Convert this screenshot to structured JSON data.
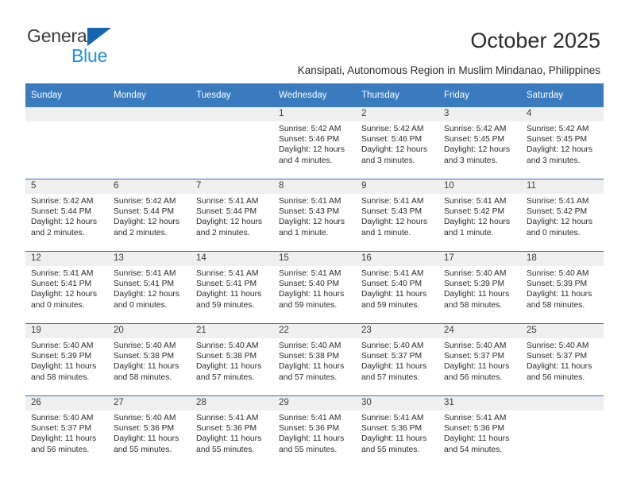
{
  "brand": {
    "name_top": "General",
    "name_bottom": "Blue",
    "triangle_color": "#1466b0",
    "blue_color": "#1e8fe0"
  },
  "header": {
    "month_title": "October 2025",
    "location": "Kansipati, Autonomous Region in Muslim Mindanao, Philippines",
    "header_bg": "#3a7bbf",
    "row_border": "#2f6eb0",
    "date_band_bg": "#efefef"
  },
  "weekdays": [
    "Sunday",
    "Monday",
    "Tuesday",
    "Wednesday",
    "Thursday",
    "Friday",
    "Saturday"
  ],
  "weeks": [
    [
      {
        "day": "",
        "empty": true
      },
      {
        "day": "",
        "empty": true
      },
      {
        "day": "",
        "empty": true
      },
      {
        "day": "1",
        "sunrise": "Sunrise: 5:42 AM",
        "sunset": "Sunset: 5:46 PM",
        "daylight": "Daylight: 12 hours and 4 minutes."
      },
      {
        "day": "2",
        "sunrise": "Sunrise: 5:42 AM",
        "sunset": "Sunset: 5:46 PM",
        "daylight": "Daylight: 12 hours and 3 minutes."
      },
      {
        "day": "3",
        "sunrise": "Sunrise: 5:42 AM",
        "sunset": "Sunset: 5:45 PM",
        "daylight": "Daylight: 12 hours and 3 minutes."
      },
      {
        "day": "4",
        "sunrise": "Sunrise: 5:42 AM",
        "sunset": "Sunset: 5:45 PM",
        "daylight": "Daylight: 12 hours and 3 minutes."
      }
    ],
    [
      {
        "day": "5",
        "sunrise": "Sunrise: 5:42 AM",
        "sunset": "Sunset: 5:44 PM",
        "daylight": "Daylight: 12 hours and 2 minutes."
      },
      {
        "day": "6",
        "sunrise": "Sunrise: 5:42 AM",
        "sunset": "Sunset: 5:44 PM",
        "daylight": "Daylight: 12 hours and 2 minutes."
      },
      {
        "day": "7",
        "sunrise": "Sunrise: 5:41 AM",
        "sunset": "Sunset: 5:44 PM",
        "daylight": "Daylight: 12 hours and 2 minutes."
      },
      {
        "day": "8",
        "sunrise": "Sunrise: 5:41 AM",
        "sunset": "Sunset: 5:43 PM",
        "daylight": "Daylight: 12 hours and 1 minute."
      },
      {
        "day": "9",
        "sunrise": "Sunrise: 5:41 AM",
        "sunset": "Sunset: 5:43 PM",
        "daylight": "Daylight: 12 hours and 1 minute."
      },
      {
        "day": "10",
        "sunrise": "Sunrise: 5:41 AM",
        "sunset": "Sunset: 5:42 PM",
        "daylight": "Daylight: 12 hours and 1 minute."
      },
      {
        "day": "11",
        "sunrise": "Sunrise: 5:41 AM",
        "sunset": "Sunset: 5:42 PM",
        "daylight": "Daylight: 12 hours and 0 minutes."
      }
    ],
    [
      {
        "day": "12",
        "sunrise": "Sunrise: 5:41 AM",
        "sunset": "Sunset: 5:41 PM",
        "daylight": "Daylight: 12 hours and 0 minutes."
      },
      {
        "day": "13",
        "sunrise": "Sunrise: 5:41 AM",
        "sunset": "Sunset: 5:41 PM",
        "daylight": "Daylight: 12 hours and 0 minutes."
      },
      {
        "day": "14",
        "sunrise": "Sunrise: 5:41 AM",
        "sunset": "Sunset: 5:41 PM",
        "daylight": "Daylight: 11 hours and 59 minutes."
      },
      {
        "day": "15",
        "sunrise": "Sunrise: 5:41 AM",
        "sunset": "Sunset: 5:40 PM",
        "daylight": "Daylight: 11 hours and 59 minutes."
      },
      {
        "day": "16",
        "sunrise": "Sunrise: 5:41 AM",
        "sunset": "Sunset: 5:40 PM",
        "daylight": "Daylight: 11 hours and 59 minutes."
      },
      {
        "day": "17",
        "sunrise": "Sunrise: 5:40 AM",
        "sunset": "Sunset: 5:39 PM",
        "daylight": "Daylight: 11 hours and 58 minutes."
      },
      {
        "day": "18",
        "sunrise": "Sunrise: 5:40 AM",
        "sunset": "Sunset: 5:39 PM",
        "daylight": "Daylight: 11 hours and 58 minutes."
      }
    ],
    [
      {
        "day": "19",
        "sunrise": "Sunrise: 5:40 AM",
        "sunset": "Sunset: 5:39 PM",
        "daylight": "Daylight: 11 hours and 58 minutes."
      },
      {
        "day": "20",
        "sunrise": "Sunrise: 5:40 AM",
        "sunset": "Sunset: 5:38 PM",
        "daylight": "Daylight: 11 hours and 58 minutes."
      },
      {
        "day": "21",
        "sunrise": "Sunrise: 5:40 AM",
        "sunset": "Sunset: 5:38 PM",
        "daylight": "Daylight: 11 hours and 57 minutes."
      },
      {
        "day": "22",
        "sunrise": "Sunrise: 5:40 AM",
        "sunset": "Sunset: 5:38 PM",
        "daylight": "Daylight: 11 hours and 57 minutes."
      },
      {
        "day": "23",
        "sunrise": "Sunrise: 5:40 AM",
        "sunset": "Sunset: 5:37 PM",
        "daylight": "Daylight: 11 hours and 57 minutes."
      },
      {
        "day": "24",
        "sunrise": "Sunrise: 5:40 AM",
        "sunset": "Sunset: 5:37 PM",
        "daylight": "Daylight: 11 hours and 56 minutes."
      },
      {
        "day": "25",
        "sunrise": "Sunrise: 5:40 AM",
        "sunset": "Sunset: 5:37 PM",
        "daylight": "Daylight: 11 hours and 56 minutes."
      }
    ],
    [
      {
        "day": "26",
        "sunrise": "Sunrise: 5:40 AM",
        "sunset": "Sunset: 5:37 PM",
        "daylight": "Daylight: 11 hours and 56 minutes."
      },
      {
        "day": "27",
        "sunrise": "Sunrise: 5:40 AM",
        "sunset": "Sunset: 5:36 PM",
        "daylight": "Daylight: 11 hours and 55 minutes."
      },
      {
        "day": "28",
        "sunrise": "Sunrise: 5:41 AM",
        "sunset": "Sunset: 5:36 PM",
        "daylight": "Daylight: 11 hours and 55 minutes."
      },
      {
        "day": "29",
        "sunrise": "Sunrise: 5:41 AM",
        "sunset": "Sunset: 5:36 PM",
        "daylight": "Daylight: 11 hours and 55 minutes."
      },
      {
        "day": "30",
        "sunrise": "Sunrise: 5:41 AM",
        "sunset": "Sunset: 5:36 PM",
        "daylight": "Daylight: 11 hours and 55 minutes."
      },
      {
        "day": "31",
        "sunrise": "Sunrise: 5:41 AM",
        "sunset": "Sunset: 5:36 PM",
        "daylight": "Daylight: 11 hours and 54 minutes."
      },
      {
        "day": "",
        "empty": true
      }
    ]
  ]
}
